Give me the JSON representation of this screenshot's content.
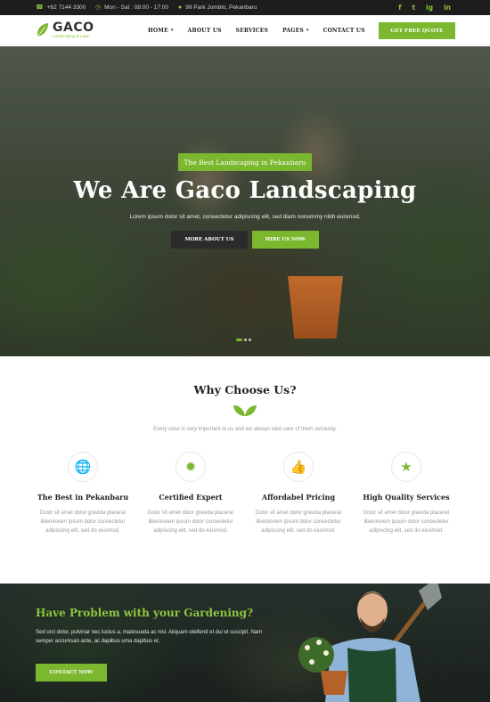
{
  "topbar": {
    "phone": "+62 7144 3300",
    "hours": "Mon - Sat : 08:00 - 17:00",
    "address": "99 Park Jomblo, Pekanbaru",
    "social": [
      "f",
      "t",
      "ig",
      "in"
    ],
    "icons": [
      "phone-icon",
      "clock-icon",
      "map-pin-icon"
    ]
  },
  "header": {
    "logo_name": "GACO",
    "logo_tagline": "Landscaping & Lawn",
    "nav": [
      {
        "label": "HOME"
      },
      {
        "label": "ABOUT US"
      },
      {
        "label": "SERVICES"
      },
      {
        "label": "PAGES"
      },
      {
        "label": "CONTACT US"
      }
    ],
    "cta": "GET FREE QUOTE"
  },
  "hero": {
    "badge": "The Best Landscaping in Pekanbaru",
    "title": "We Are Gaco Landscaping",
    "subtitle": "Lorem ipsum dolor sit amet, consectetur adipiscing elit, sed diam nonummy nibh euismod.",
    "btn_primary": "MORE ABOUT US",
    "btn_secondary": "HIRE US NOW",
    "slide_count": 3,
    "active_slide": 1
  },
  "why": {
    "title": "Why Choose Us?",
    "subtitle": "Every case is very important to us and we always take care of them seriously.",
    "features": [
      {
        "icon": "globe-icon",
        "title": "The Best in Pekanbaru",
        "text": "Dolor sit amet dolor gravida placerat liberolorem ipsum dolor consectetur adipiscing elit, sed do eiusmod."
      },
      {
        "icon": "badge-icon",
        "title": "Certified Expert",
        "text": "Dolor sit amet dolor gravida placerat liberolorem ipsum dolor consectetur adipiscing elit, sed do eiusmod."
      },
      {
        "icon": "thumbs-up-icon",
        "title": "Affordabel Pricing",
        "text": "Dolor sit amet dolor gravida placerat liberolorem ipsum dolor consectetur adipiscing elit, sed do eiusmod."
      },
      {
        "icon": "star-icon",
        "title": "High Quality Services",
        "text": "Dolor sit amet dolor gravida placerat liberolorem ipsum dolor consectetur adipiscing elit, sed do eiusmod."
      }
    ]
  },
  "cta": {
    "title": "Have Problem with your Gardening?",
    "text": "Sed orci dolor, pulvinar nec luctus a, malesuada ac nisl. Aliquam eleifend et dui et suscipit. Nam semper accumsan ante, ac dapibus urna dapibus et.",
    "button": "CONTACT NOW"
  },
  "colors": {
    "accent": "#7cb82f",
    "dark": "#1d1d1d"
  }
}
